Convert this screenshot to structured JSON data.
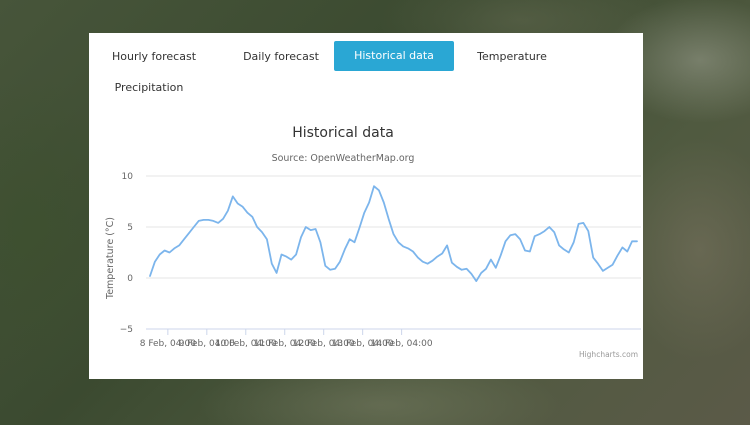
{
  "tabs": [
    {
      "label": "Hourly forecast",
      "active": false
    },
    {
      "label": "Daily forecast",
      "active": false
    },
    {
      "label": "Historical data",
      "active": true
    },
    {
      "label": "Temperature",
      "active": false
    },
    {
      "label": "Precipitation",
      "active": false
    }
  ],
  "credits": "Highcharts.com",
  "colors": {
    "accent": "#2aa7d4",
    "series": "#7cb5ec",
    "grid": "#e6e6e6"
  },
  "chart_data": {
    "type": "line",
    "title": "Historical data",
    "subtitle": "Source: OpenWeatherMap.org",
    "ylabel": "Temperature (°C)",
    "xlabel": "",
    "ylim": [
      -5,
      10
    ],
    "yticks": [
      "10",
      "5",
      "0",
      "−5"
    ],
    "xticks": [
      "8 Feb, 04:00",
      "9 Feb, 04:00",
      "10 Feb, 04:00",
      "11 Feb, 04:00",
      "12 Feb, 04:00",
      "13 Feb, 04:00",
      "14 Feb, 04:00"
    ],
    "grid": true,
    "legend": "none",
    "series": [
      {
        "x_start": "7 Feb, 17:00",
        "x_step_hours": 3,
        "values": [
          0.2,
          1.6,
          2.3,
          2.7,
          2.5,
          2.9,
          3.2,
          3.8,
          4.4,
          5.0,
          5.6,
          5.7,
          5.7,
          5.6,
          5.4,
          5.8,
          6.6,
          8.0,
          7.3,
          7.0,
          6.4,
          6.0,
          5.0,
          4.5,
          3.8,
          1.4,
          0.5,
          2.3,
          2.1,
          1.8,
          2.3,
          4.0,
          5.0,
          4.7,
          4.8,
          3.5,
          1.2,
          0.8,
          0.9,
          1.6,
          2.8,
          3.8,
          3.5,
          4.9,
          6.4,
          7.4,
          9.0,
          8.6,
          7.4,
          5.8,
          4.3,
          3.5,
          3.1,
          2.9,
          2.6,
          2.0,
          1.6,
          1.4,
          1.7,
          2.1,
          2.4,
          3.2,
          1.5,
          1.1,
          0.8,
          0.9,
          0.4,
          -0.3,
          0.5,
          0.9,
          1.8,
          1.0,
          2.2,
          3.6,
          4.2,
          4.3,
          3.8,
          2.7,
          2.6,
          4.1,
          4.3,
          4.6,
          5.0,
          4.5,
          3.2,
          2.8,
          2.5,
          3.5,
          5.3,
          5.4,
          4.6,
          2.0,
          1.4,
          0.7,
          1.0,
          1.3,
          2.2,
          3.0,
          2.6,
          3.6,
          3.6
        ]
      }
    ]
  }
}
